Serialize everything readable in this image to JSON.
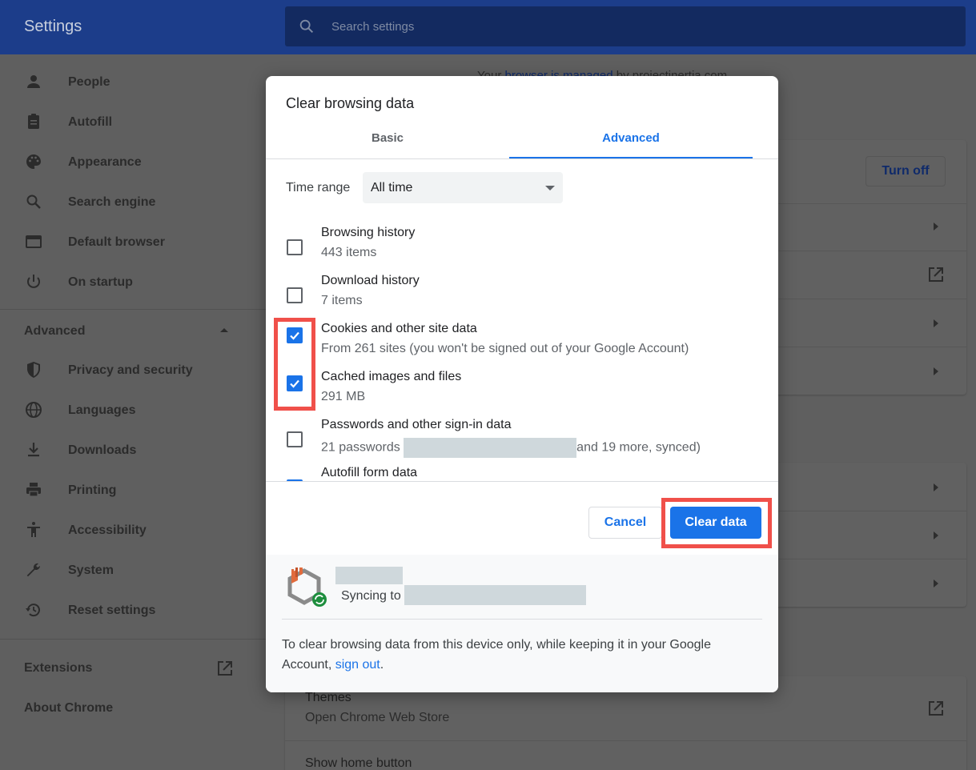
{
  "app": {
    "title": "Settings"
  },
  "search": {
    "placeholder": "Search settings"
  },
  "sidebar": {
    "items": [
      {
        "label": "People",
        "icon": "person-icon"
      },
      {
        "label": "Autofill",
        "icon": "clipboard-icon"
      },
      {
        "label": "Appearance",
        "icon": "palette-icon"
      },
      {
        "label": "Search engine",
        "icon": "search-icon"
      },
      {
        "label": "Default browser",
        "icon": "browser-window-icon"
      },
      {
        "label": "On startup",
        "icon": "power-icon"
      }
    ],
    "advanced_label": "Advanced",
    "advanced_items": [
      {
        "label": "Privacy and security",
        "icon": "shield-icon"
      },
      {
        "label": "Languages",
        "icon": "globe-icon"
      },
      {
        "label": "Downloads",
        "icon": "download-icon"
      },
      {
        "label": "Printing",
        "icon": "printer-icon"
      },
      {
        "label": "Accessibility",
        "icon": "accessibility-icon"
      },
      {
        "label": "System",
        "icon": "wrench-icon"
      },
      {
        "label": "Reset settings",
        "icon": "history-icon"
      }
    ],
    "extensions_label": "Extensions",
    "about_label": "About Chrome"
  },
  "background": {
    "managed_text_start": "Your ",
    "managed_link": "browser is managed",
    "managed_text_end": " by projectinertia.com",
    "turn_off_label": "Turn off",
    "themes_title": "Themes",
    "themes_sub": "Open Chrome Web Store",
    "home_button_label": "Show home button"
  },
  "dialog": {
    "title": "Clear browsing data",
    "tabs": {
      "basic": "Basic",
      "advanced": "Advanced",
      "active": "Advanced"
    },
    "time_range_label": "Time range",
    "time_range_value": "All time",
    "items": [
      {
        "title": "Browsing history",
        "sub": "443 items",
        "checked": false
      },
      {
        "title": "Download history",
        "sub": "7 items",
        "checked": false
      },
      {
        "title": "Cookies and other site data",
        "sub": "From 261 sites (you won't be signed out of your Google Account)",
        "checked": true
      },
      {
        "title": "Cached images and files",
        "sub": "291 MB",
        "checked": true
      },
      {
        "title": "Passwords and other sign-in data",
        "sub_start": "21 passwords ",
        "sub_end": "and 19 more, synced)",
        "checked": false
      },
      {
        "title": "Autofill form data",
        "checked": true
      }
    ],
    "cancel_label": "Cancel",
    "clear_label": "Clear data",
    "sync_label": "Syncing to",
    "note_text": "To clear browsing data from this device only, while keeping it in your Google Account, ",
    "note_link": "sign out",
    "note_end": "."
  },
  "colors": {
    "accent": "#1a73e8",
    "highlight": "#f0504a",
    "topbar": "#1c3d8a"
  }
}
